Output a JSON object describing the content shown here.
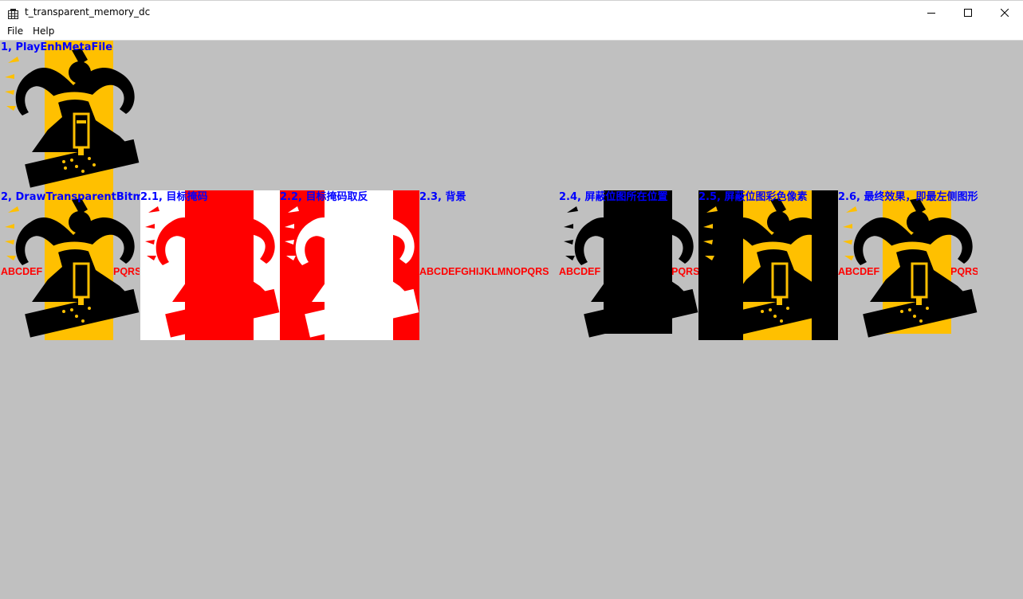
{
  "window": {
    "title": "t_transparent_memory_dc",
    "icon": "app-grid-icon",
    "controls": [
      "minimize-icon",
      "maximize-icon",
      "close-icon"
    ]
  },
  "menu": {
    "items": [
      "File",
      "Help"
    ]
  },
  "labels": {
    "play_enh_metafile": "1, PlayEnhMetaFile",
    "draw_transparent_bitmap": "2, DrawTransparentBitmap",
    "step_2_1": "2.1, 目标掩码",
    "step_2_2": "2.2, 目标掩码取反",
    "step_2_3": "2.3, 背景",
    "step_2_4": "2.4, 屏蔽位图所在位置",
    "step_2_5": "2.5, 屏蔽位图彩色像素",
    "step_2_6": "2.6, 最终效果，即最左侧图形"
  },
  "background_text": {
    "full": "ABCDEFGHIJKLMNOPQRS",
    "left_part": "ABCDEF",
    "right_part": "QRS",
    "right_part_short": "PQRS"
  },
  "colors": {
    "client_bg": "#c0c0c0",
    "label_blue": "#0000ff",
    "text_red": "#ff0000",
    "figure_yellow": "#ffc000",
    "mask_red": "#ff0000",
    "figure_black": "#000000"
  }
}
